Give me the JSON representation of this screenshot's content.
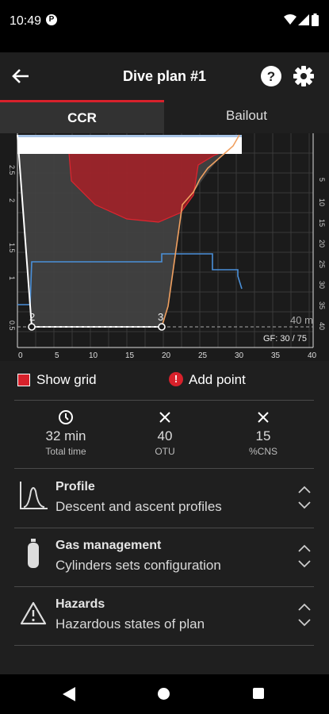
{
  "status_bar": {
    "time": "10:49",
    "app_icon": "P",
    "icons": [
      "p-icon",
      "wifi-icon",
      "signal-icon",
      "battery-icon"
    ]
  },
  "app_bar": {
    "title": "Dive plan #1",
    "icons": [
      "back-arrow-icon",
      "help-icon",
      "gear-icon"
    ]
  },
  "tabs": [
    {
      "label": "CCR",
      "selected": true
    },
    {
      "label": "Bailout",
      "selected": false
    }
  ],
  "chart": {
    "depth_label": "40 m",
    "gf_label": "GF: 30 / 75",
    "points": [
      "2",
      "3"
    ],
    "x_ticks": [
      "0",
      "5",
      "10",
      "15",
      "20",
      "25",
      "30",
      "35",
      "40"
    ],
    "left_ticks": [
      "2.5",
      "2",
      "1.5",
      "1",
      "0.5"
    ],
    "right_ticks": [
      "5",
      "10",
      "15",
      "20",
      "25",
      "30",
      "35",
      "40"
    ],
    "colors": {
      "background": "#1b1b1b",
      "ceiling": "#d8212b",
      "profile": "#ffffff",
      "po2": "#4a90d9",
      "ascent": "#f0a060"
    }
  },
  "options": {
    "show_grid_label": "Show grid",
    "show_grid_checked": true,
    "add_point_label": "Add point",
    "add_point_icon": "!"
  },
  "stats": [
    {
      "icon": "clock-icon",
      "value": "32 min",
      "label": "Total time"
    },
    {
      "icon": "close-icon",
      "value": "40",
      "label": "OTU"
    },
    {
      "icon": "close-icon",
      "value": "15",
      "label": "%CNS"
    }
  ],
  "sections": [
    {
      "icon": "profile-curve-icon",
      "title": "Profile",
      "subtitle": "Descent and ascent profiles"
    },
    {
      "icon": "cylinder-icon",
      "title": "Gas management",
      "subtitle": "Cylinders sets configuration"
    },
    {
      "icon": "warning-icon",
      "title": "Hazards",
      "subtitle": "Hazardous states of plan"
    }
  ],
  "nav_bar": {
    "icons": [
      "back-icon",
      "home-icon",
      "recents-icon"
    ]
  }
}
